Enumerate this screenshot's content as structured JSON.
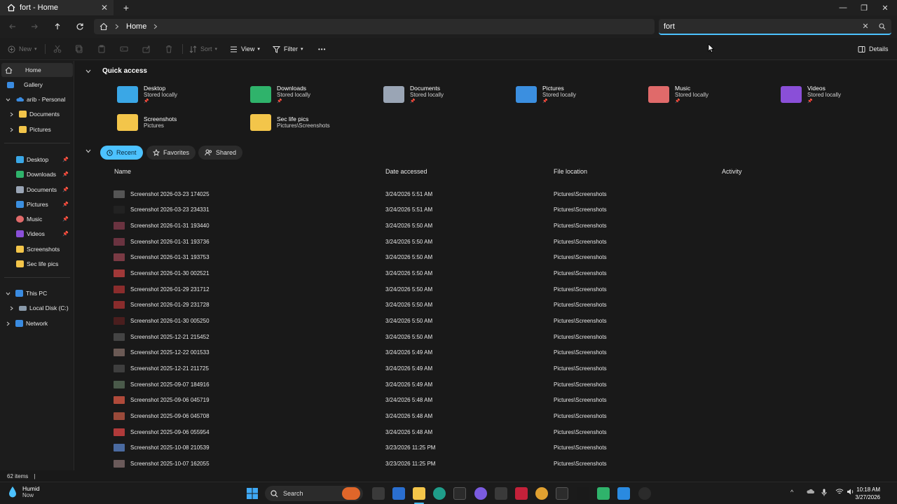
{
  "window": {
    "tab_title": "fort - Home",
    "new_tab_label": "+",
    "minimize_glyph": "—",
    "maximize_glyph": "❐",
    "close_glyph": "✕",
    "tab_close_glyph": "✕"
  },
  "address": {
    "breadcrumb": "Home",
    "search_value": "fort",
    "search_clear_glyph": "✕"
  },
  "commands": {
    "new": "New",
    "sort": "Sort",
    "view": "View",
    "filter": "Filter",
    "more": "•••",
    "details": "Details"
  },
  "sidebar": {
    "home": "Home",
    "gallery": "Gallery",
    "onedrive": "arib - Personal",
    "od_documents": "Documents",
    "od_pictures": "Pictures",
    "desktop": "Desktop",
    "downloads": "Downloads",
    "documents": "Documents",
    "pictures": "Pictures",
    "music": "Music",
    "videos": "Videos",
    "screenshots": "Screenshots",
    "sec_life_pics": "Sec life pics",
    "this_pc": "This PC",
    "local_disk": "Local Disk (C:)",
    "network": "Network"
  },
  "quick_access": {
    "title": "Quick access",
    "items": [
      {
        "name": "Desktop",
        "sub": "Stored locally",
        "color": "#3aa7e6"
      },
      {
        "name": "Downloads",
        "sub": "Stored locally",
        "color": "#2fb36b"
      },
      {
        "name": "Documents",
        "sub": "Stored locally",
        "color": "#9aa5b5"
      },
      {
        "name": "Pictures",
        "sub": "Stored locally",
        "color": "#3b8fe0"
      },
      {
        "name": "Music",
        "sub": "Stored locally",
        "color": "#e06a6a"
      },
      {
        "name": "Videos",
        "sub": "Stored locally",
        "color": "#8a4fd8"
      },
      {
        "name": "Screenshots",
        "sub": "Pictures",
        "color": "#f3c54a"
      },
      {
        "name": "Sec life pics",
        "sub": "Pictures\\Screenshots",
        "color": "#f3c54a"
      }
    ]
  },
  "recent": {
    "tabs": [
      "Recent",
      "Favorites",
      "Shared"
    ],
    "columns": [
      "Name",
      "Date accessed",
      "File location",
      "Activity"
    ],
    "rows": [
      {
        "name": "Screenshot 2026-03-23 174025",
        "date": "3/24/2026 5:51 AM",
        "loc": "Pictures\\Screenshots",
        "thumb": "#555"
      },
      {
        "name": "Screenshot 2026-03-23 234331",
        "date": "3/24/2026 5:51 AM",
        "loc": "Pictures\\Screenshots",
        "thumb": "#222"
      },
      {
        "name": "Screenshot 2026-01-31 193440",
        "date": "3/24/2026 5:50 AM",
        "loc": "Pictures\\Screenshots",
        "thumb": "#6a3340"
      },
      {
        "name": "Screenshot 2026-01-31 193736",
        "date": "3/24/2026 5:50 AM",
        "loc": "Pictures\\Screenshots",
        "thumb": "#6a3340"
      },
      {
        "name": "Screenshot 2026-01-31 193753",
        "date": "3/24/2026 5:50 AM",
        "loc": "Pictures\\Screenshots",
        "thumb": "#7a3a44"
      },
      {
        "name": "Screenshot 2026-01-30 002521",
        "date": "3/24/2026 5:50 AM",
        "loc": "Pictures\\Screenshots",
        "thumb": "#a03838"
      },
      {
        "name": "Screenshot 2026-01-29 231712",
        "date": "3/24/2026 5:50 AM",
        "loc": "Pictures\\Screenshots",
        "thumb": "#8a2c2c"
      },
      {
        "name": "Screenshot 2026-01-29 231728",
        "date": "3/24/2026 5:50 AM",
        "loc": "Pictures\\Screenshots",
        "thumb": "#8a2c2c"
      },
      {
        "name": "Screenshot 2026-01-30 005250",
        "date": "3/24/2026 5:50 AM",
        "loc": "Pictures\\Screenshots",
        "thumb": "#4a1e1e"
      },
      {
        "name": "Screenshot 2025-12-21 215452",
        "date": "3/24/2026 5:50 AM",
        "loc": "Pictures\\Screenshots",
        "thumb": "#444"
      },
      {
        "name": "Screenshot 2025-12-22 001533",
        "date": "3/24/2026 5:49 AM",
        "loc": "Pictures\\Screenshots",
        "thumb": "#6b5a55"
      },
      {
        "name": "Screenshot 2025-12-21 211725",
        "date": "3/24/2026 5:49 AM",
        "loc": "Pictures\\Screenshots",
        "thumb": "#3e3e3e"
      },
      {
        "name": "Screenshot 2025-09-07 184916",
        "date": "3/24/2026 5:49 AM",
        "loc": "Pictures\\Screenshots",
        "thumb": "#4a5a4a"
      },
      {
        "name": "Screenshot 2025-09-06 045719",
        "date": "3/24/2026 5:48 AM",
        "loc": "Pictures\\Screenshots",
        "thumb": "#b04a3a"
      },
      {
        "name": "Screenshot 2025-09-06 045708",
        "date": "3/24/2026 5:48 AM",
        "loc": "Pictures\\Screenshots",
        "thumb": "#9a4a3a"
      },
      {
        "name": "Screenshot 2025-09-06 055954",
        "date": "3/24/2026 5:48 AM",
        "loc": "Pictures\\Screenshots",
        "thumb": "#b03a3a"
      },
      {
        "name": "Screenshot 2025-10-08 210539",
        "date": "3/23/2026 11:25 PM",
        "loc": "Pictures\\Screenshots",
        "thumb": "#4a6aa0"
      },
      {
        "name": "Screenshot 2025-10-07 162055",
        "date": "3/23/2026 11:25 PM",
        "loc": "Pictures\\Screenshots",
        "thumb": "#6a5a5a"
      }
    ]
  },
  "status": {
    "item_count": "62 items",
    "sep": "|"
  },
  "taskbar": {
    "weather_title": "Humid",
    "weather_sub": "Now",
    "search_label": "Search",
    "time": "10:18 AM",
    "date": "3/27/2026",
    "tray_chevron": "^"
  },
  "colors": {
    "accent": "#4cc2ff",
    "folder_yellow": "#f3c54a"
  }
}
